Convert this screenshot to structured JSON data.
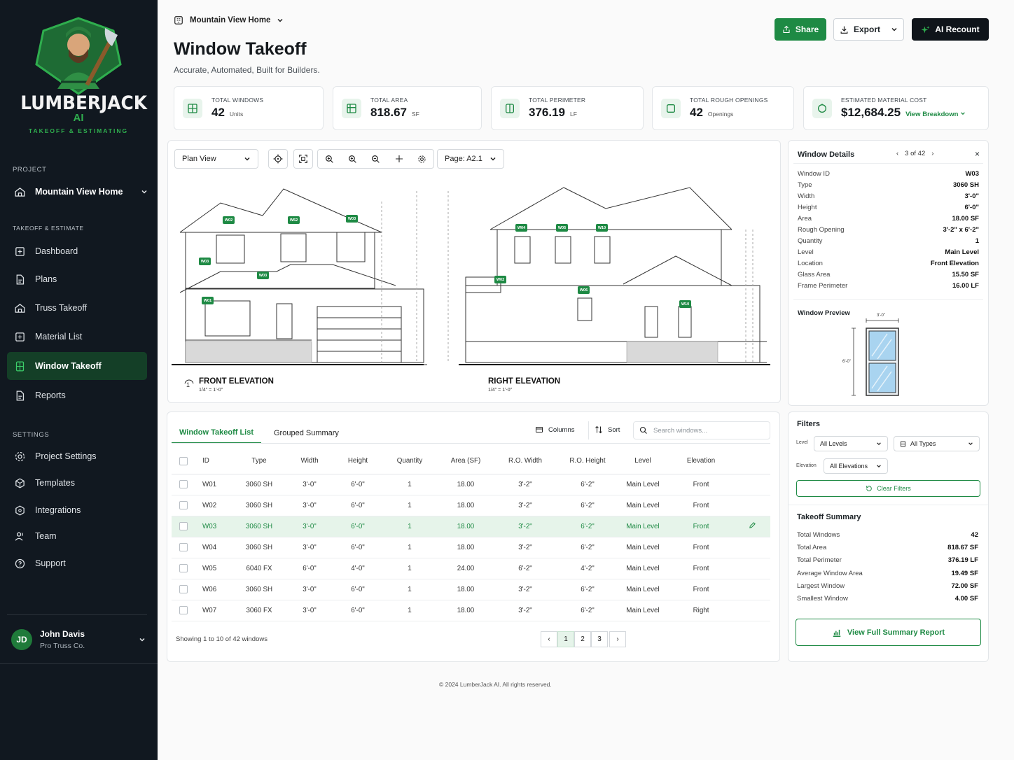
{
  "brand": {
    "name": "LUMBERJACK",
    "ai": "AI",
    "tagline": "TAKEOFF & ESTIMATING"
  },
  "sidebar": {
    "project_label": "PROJECT",
    "project_name": "Mountain View Home",
    "takeoff_label": "TAKEOFF & ESTIMATE",
    "items": [
      {
        "label": "Dashboard",
        "icon": "dashboard-icon"
      },
      {
        "label": "Plans",
        "icon": "plans-icon"
      },
      {
        "label": "Truss Takeoff",
        "icon": "house-icon"
      },
      {
        "label": "Material List",
        "icon": "list-icon"
      },
      {
        "label": "Window Takeoff",
        "icon": "window-icon",
        "active": true
      },
      {
        "label": "Reports",
        "icon": "report-icon"
      }
    ],
    "settings_label": "SETTINGS",
    "settings": [
      {
        "label": "Project Settings",
        "icon": "gear-icon"
      },
      {
        "label": "Templates",
        "icon": "templates-icon"
      },
      {
        "label": "Integrations",
        "icon": "integrations-icon"
      },
      {
        "label": "Team",
        "icon": "team-icon"
      },
      {
        "label": "Support",
        "icon": "support-icon"
      }
    ],
    "user": {
      "initials": "JD",
      "name": "John Davis",
      "company": "Pro Truss Co."
    }
  },
  "header": {
    "breadcrumb": "Mountain View Home",
    "title": "Window Takeoff",
    "subtitle": "Accurate, Automated, Built for Builders.",
    "share": "Share",
    "export": "Export",
    "ai_recount": "AI Recount"
  },
  "stats": [
    {
      "label": "TOTAL WINDOWS",
      "value": "42",
      "unit": "Units"
    },
    {
      "label": "TOTAL AREA",
      "value": "818.67",
      "unit": "SF"
    },
    {
      "label": "TOTAL PERIMETER",
      "value": "376.19",
      "unit": "LF"
    },
    {
      "label": "TOTAL ROUGH OPENINGS",
      "value": "42",
      "unit": "Openings"
    },
    {
      "label": "ESTIMATED MATERIAL COST",
      "value": "$12,684.25",
      "link": "View Breakdown"
    }
  ],
  "viewer": {
    "view": "Plan View",
    "page": "Page: A2.1",
    "front_title": "FRONT ELEVATION",
    "front_scale": "1/4\" = 1'-0\"",
    "front_num": "1",
    "right_title": "RIGHT ELEVATION",
    "right_scale": "1/4\" = 1'-0\"",
    "tags": [
      "W02",
      "W52",
      "W03",
      "W03",
      "W03",
      "W01",
      "W04",
      "W05",
      "W10",
      "W02",
      "W06",
      "W10"
    ]
  },
  "details": {
    "title": "Window Details",
    "pager": "3 of 42",
    "rows": [
      {
        "k": "Window ID",
        "v": "W03"
      },
      {
        "k": "Type",
        "v": "3060 SH"
      },
      {
        "k": "Width",
        "v": "3'-0\""
      },
      {
        "k": "Height",
        "v": "6'-0\""
      },
      {
        "k": "Area",
        "v": "18.00 SF"
      },
      {
        "k": "Rough Opening",
        "v": "3'-2\" x 6'-2\""
      },
      {
        "k": "Quantity",
        "v": "1"
      },
      {
        "k": "Level",
        "v": "Main Level"
      },
      {
        "k": "Location",
        "v": "Front Elevation"
      },
      {
        "k": "Glass Area",
        "v": "15.50 SF"
      },
      {
        "k": "Frame Perimeter",
        "v": "16.00 LF"
      }
    ],
    "preview_label": "Window Preview",
    "preview_w": "3'-0\"",
    "preview_h": "6'-0\""
  },
  "list": {
    "tab_active": "Window Takeoff List",
    "tab_other": "Grouped Summary",
    "columns_btn": "Columns",
    "sort_btn": "Sort",
    "search_placeholder": "Search windows...",
    "headers": [
      "ID",
      "Type",
      "Width",
      "Height",
      "Quantity",
      "Area (SF)",
      "R.O. Width",
      "R.O. Height",
      "Level",
      "Elevation"
    ],
    "rows": [
      [
        "W01",
        "3060 SH",
        "3'-0\"",
        "6'-0\"",
        "1",
        "18.00",
        "3'-2\"",
        "6'-2\"",
        "Main Level",
        "Front"
      ],
      [
        "W02",
        "3060 SH",
        "3'-0\"",
        "6'-0\"",
        "1",
        "18.00",
        "3'-2\"",
        "6'-2\"",
        "Main Level",
        "Front"
      ],
      [
        "W03",
        "3060 SH",
        "3'-0\"",
        "6'-0\"",
        "1",
        "18.00",
        "3'-2\"",
        "6'-2\"",
        "Main Level",
        "Front"
      ],
      [
        "W04",
        "3060 SH",
        "3'-0\"",
        "6'-0\"",
        "1",
        "18.00",
        "3'-2\"",
        "6'-2\"",
        "Main Level",
        "Front"
      ],
      [
        "W05",
        "6040 FX",
        "6'-0\"",
        "4'-0\"",
        "1",
        "24.00",
        "6'-2\"",
        "4'-2\"",
        "Main Level",
        "Front"
      ],
      [
        "W06",
        "3060 SH",
        "3'-0\"",
        "6'-0\"",
        "1",
        "18.00",
        "3'-2\"",
        "6'-2\"",
        "Main Level",
        "Front"
      ],
      [
        "W07",
        "3060 FX",
        "3'-0\"",
        "6'-0\"",
        "1",
        "18.00",
        "3'-2\"",
        "6'-2\"",
        "Main Level",
        "Right"
      ]
    ],
    "selected_index": 2,
    "showing": "Showing 1 to 10 of 42 windows",
    "pages": [
      "1",
      "2",
      "3"
    ]
  },
  "filters": {
    "title": "Filters",
    "level_label": "Level",
    "level": "All Levels",
    "type": "All Types",
    "elevation_label": "Elevation",
    "elevation": "All Elevations",
    "clear": "Clear Filters"
  },
  "summary": {
    "title": "Takeoff Summary",
    "rows": [
      {
        "k": "Total Windows",
        "v": "42"
      },
      {
        "k": "Total Area",
        "v": "818.67 SF"
      },
      {
        "k": "Total Perimeter",
        "v": "376.19 LF"
      },
      {
        "k": "Average Window Area",
        "v": "19.49 SF"
      },
      {
        "k": "Largest Window",
        "v": "72.00 SF"
      },
      {
        "k": "Smallest Window",
        "v": "4.00 SF"
      }
    ],
    "button": "View Full Summary Report"
  },
  "footer": "© 2024 LumberJack AI. All rights reserved.",
  "colors": {
    "accent": "#1e8a44",
    "sidebar": "#111820",
    "active": "#143f27"
  }
}
